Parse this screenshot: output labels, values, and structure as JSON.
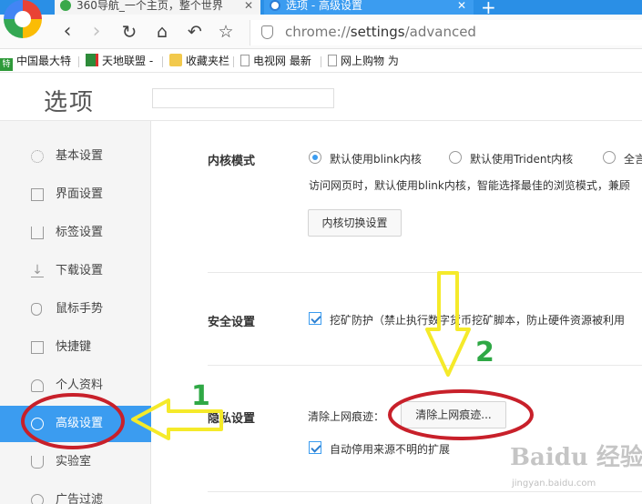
{
  "tabs": [
    {
      "title": "360导航_一个主页，整个世界",
      "active": false
    },
    {
      "title": "选项 - 高级设置",
      "active": true
    }
  ],
  "toolbar": {
    "url_scheme": "chrome://",
    "url_host": "settings",
    "url_path": "/advanced"
  },
  "bookmarks": [
    {
      "icon": "green-tag-icon",
      "icon_text": "特",
      "label": "中国最大特"
    },
    {
      "icon": "flag-icon",
      "label": "天地联盟 -"
    },
    {
      "icon": "folder-icon",
      "label": "收藏夹栏"
    },
    {
      "icon": "page-icon",
      "label": "电视网 最新"
    },
    {
      "icon": "page-icon",
      "label": "网上购物 为"
    }
  ],
  "page": {
    "title": "选项",
    "search_placeholder": ""
  },
  "sidebar": {
    "items": [
      {
        "label": "基本设置",
        "icon": "gear-icon"
      },
      {
        "label": "界面设置",
        "icon": "window-icon"
      },
      {
        "label": "标签设置",
        "icon": "tab-icon"
      },
      {
        "label": "下载设置",
        "icon": "download-icon"
      },
      {
        "label": "鼠标手势",
        "icon": "mouse-icon"
      },
      {
        "label": "快捷键",
        "icon": "keyboard-icon"
      },
      {
        "label": "个人资料",
        "icon": "person-icon"
      },
      {
        "label": "高级设置",
        "icon": "wrench-icon",
        "active": true
      },
      {
        "label": "实验室",
        "icon": "flask-icon"
      },
      {
        "label": "广告过滤",
        "icon": "block-icon"
      }
    ]
  },
  "kernel": {
    "label": "内核模式",
    "options": [
      "默认使用blink内核",
      "默认使用Trident内核",
      "全言"
    ],
    "selected": 0,
    "description": "访问网页时，默认使用blink内核，智能选择最佳的浏览模式，兼顾",
    "switch_button": "内核切换设置"
  },
  "security": {
    "label": "安全设置",
    "checkbox_label": "挖矿防护（禁止执行数字货币挖矿脚本，防止硬件资源被利用",
    "checked": true
  },
  "privacy": {
    "label": "隐私设置",
    "clear_label": "清除上网痕迹：",
    "clear_button": "清除上网痕迹...",
    "auto_disable_label": "自动停用来源不明的扩展",
    "auto_disable_checked": true
  },
  "annotations": {
    "step1": "1",
    "step2": "2"
  },
  "watermark": {
    "text": "Baidu 经验",
    "url": "jingyan.baidu.com"
  },
  "colors": {
    "accent": "#3b9cf0",
    "annotation_ring": "#c8202a",
    "annotation_arrow": "#f5ea2a",
    "annotation_number": "#2fa845"
  }
}
